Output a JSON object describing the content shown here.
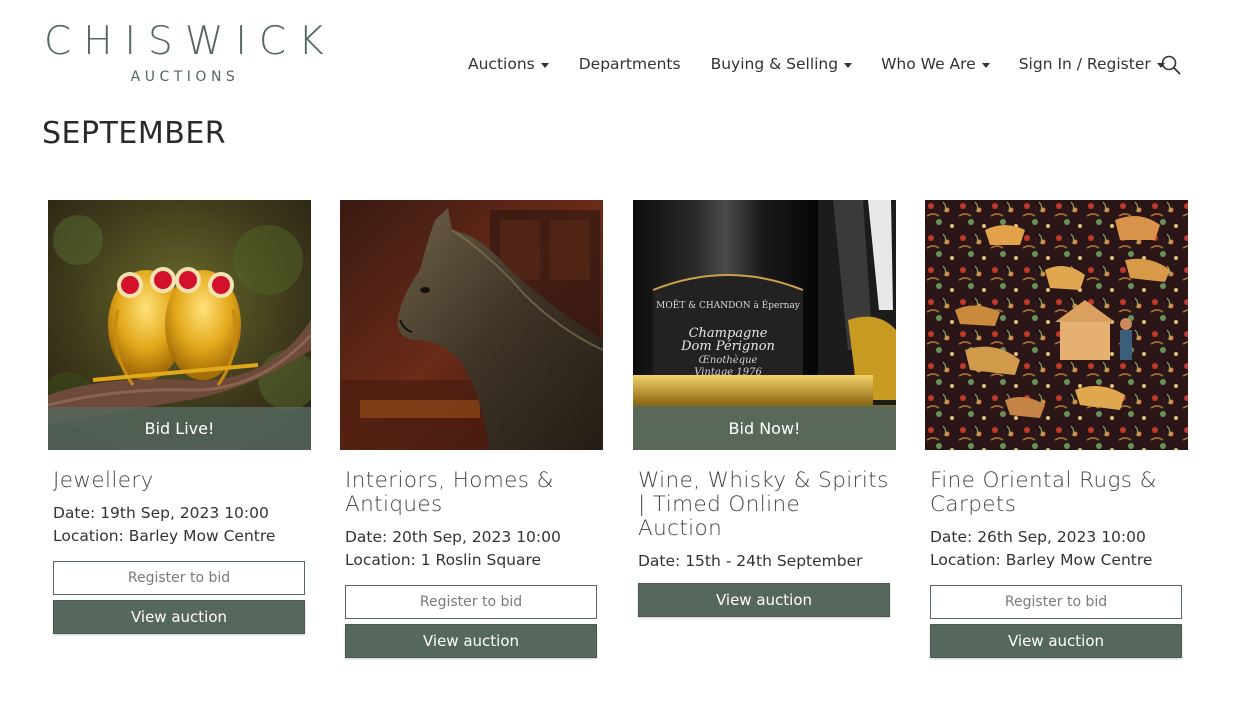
{
  "brand": {
    "name": "CHISWICK",
    "sub": "AUCTIONS",
    "color": "#56675e"
  },
  "nav": {
    "items": [
      {
        "label": "Auctions",
        "dropdown": true
      },
      {
        "label": "Departments",
        "dropdown": false
      },
      {
        "label": "Buying & Selling",
        "dropdown": true
      },
      {
        "label": "Who We Are",
        "dropdown": true
      },
      {
        "label": "Sign In / Register",
        "dropdown": true
      }
    ],
    "search_icon": "search-icon"
  },
  "page": {
    "title": "SEPTEMBER"
  },
  "cards": [
    {
      "title": "Jewellery",
      "date": "Date: 19th Sep, 2023 10:00",
      "location": "Location: Barley Mow Centre",
      "overlay": "Bid Live!",
      "register": "Register to bid",
      "view": "View auction",
      "image": "gold-owl-brooch"
    },
    {
      "title": "Interiors, Homes & Antiques",
      "date": "Date: 20th Sep, 2023 10:00",
      "location": "Location: 1 Roslin Square",
      "overlay": "",
      "register": "Register to bid",
      "view": "View auction",
      "image": "bronze-horse-sculpture"
    },
    {
      "title": "Wine, Whisky & Spirits | Timed Online Auction",
      "date": "Date: 15th - 24th September",
      "location": "",
      "overlay": "Bid Now!",
      "register": "",
      "view": "View auction",
      "image": "champagne-bottle"
    },
    {
      "title": "Fine Oriental Rugs & Carpets",
      "date": "Date: 26th Sep, 2023 10:00",
      "location": "Location: Barley Mow Centre",
      "overlay": "",
      "register": "Register to bid",
      "view": "View auction",
      "image": "oriental-rug"
    }
  ]
}
